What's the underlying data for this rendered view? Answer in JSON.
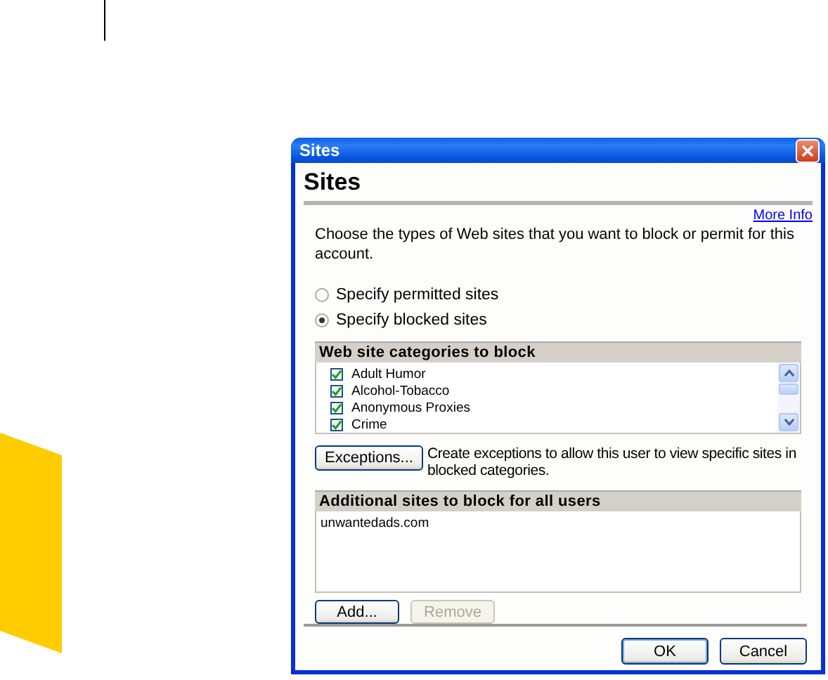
{
  "window": {
    "title": "Sites"
  },
  "heading": "Sites",
  "more_info": "More Info",
  "intro": "Choose the types of Web sites that you want to block or permit for this account.",
  "modes": [
    {
      "label": "Specify permitted sites",
      "selected": false
    },
    {
      "label": "Specify blocked sites",
      "selected": true
    }
  ],
  "categories": {
    "title": "Web site categories to block",
    "items": [
      {
        "label": "Adult Humor",
        "checked": true
      },
      {
        "label": "Alcohol-Tobacco",
        "checked": true
      },
      {
        "label": "Anonymous Proxies",
        "checked": true
      },
      {
        "label": "Crime",
        "checked": true
      }
    ]
  },
  "exceptions": {
    "button": "Exceptions...",
    "description": "Create exceptions to allow this user to view specific sites in blocked categories."
  },
  "additional": {
    "title": "Additional sites to block for all users",
    "sites": [
      "unwantedads.com"
    ]
  },
  "site_buttons": [
    {
      "label": "Add...",
      "disabled": false
    },
    {
      "label": "Remove",
      "disabled": true
    }
  ],
  "buttons": [
    "OK",
    "Cancel"
  ]
}
